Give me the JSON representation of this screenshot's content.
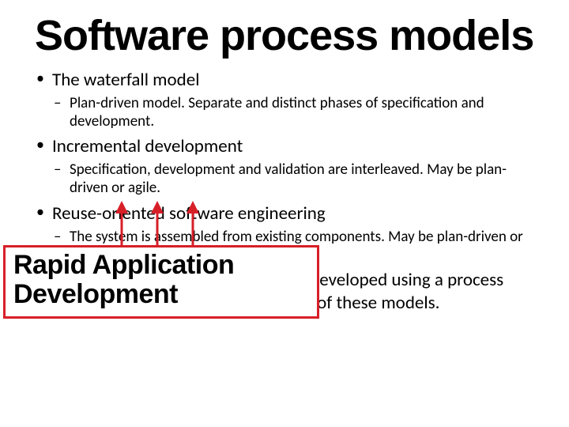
{
  "title": "Software process models",
  "bullets": [
    {
      "text": "The waterfall model",
      "sub": [
        "Plan-driven model. Separate and distinct phases of specification and development."
      ]
    },
    {
      "text": "Incremental development",
      "sub": [
        "Specification, development and validation are interleaved. May be plan-driven or agile."
      ]
    },
    {
      "text": "Reuse-oriented software engineering",
      "sub": [
        "The system is assembled from existing components. May be plan-driven or agile"
      ]
    },
    {
      "text": "In practice, most large systems are developed using a process that incorporates elements from all of these models.",
      "sub": []
    }
  ],
  "overlay": {
    "line1": "Rapid Application",
    "line2": "Development"
  }
}
